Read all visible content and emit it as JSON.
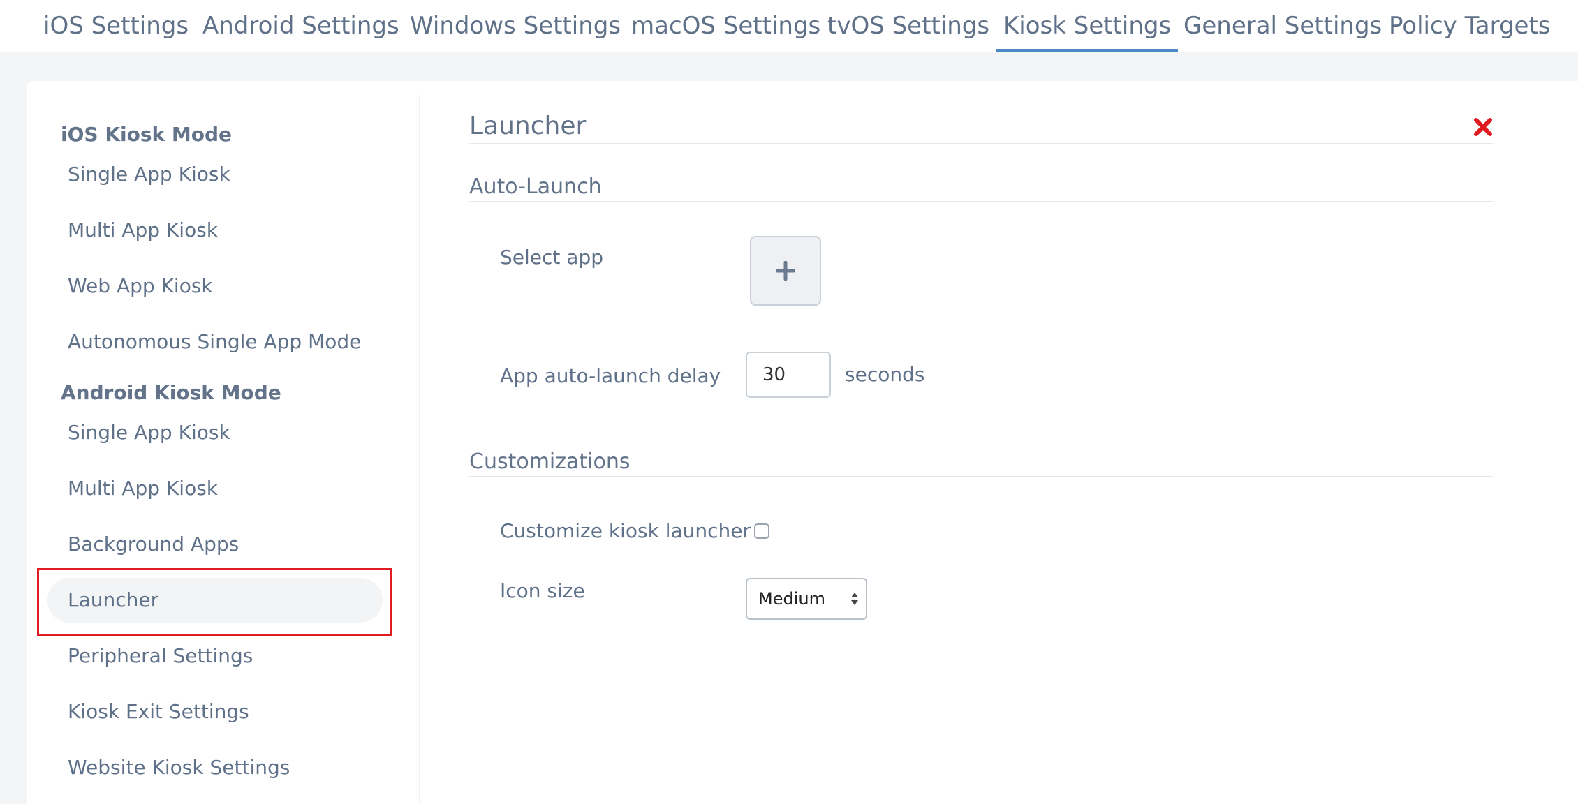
{
  "tabs": [
    {
      "label": "iOS Settings",
      "active": false
    },
    {
      "label": "Android Settings",
      "active": false
    },
    {
      "label": "Windows Settings",
      "active": false
    },
    {
      "label": "macOS Settings",
      "active": false
    },
    {
      "label": "tvOS Settings",
      "active": false
    },
    {
      "label": "Kiosk Settings",
      "active": true
    },
    {
      "label": "General Settings",
      "active": false
    },
    {
      "label": "Policy Targets",
      "active": false
    }
  ],
  "sidebar": {
    "ios_group": "iOS Kiosk Mode",
    "ios_items": [
      "Single App Kiosk",
      "Multi App Kiosk",
      "Web App Kiosk",
      "Autonomous Single App Mode"
    ],
    "android_group": "Android Kiosk Mode",
    "android_items": [
      "Single App Kiosk",
      "Multi App Kiosk",
      "Background Apps",
      "Launcher",
      "Peripheral Settings",
      "Kiosk Exit Settings",
      "Website Kiosk Settings"
    ],
    "selected": "Launcher"
  },
  "panel": {
    "title": "Launcher",
    "close_icon": "close-x-icon",
    "auto_launch": {
      "section_title": "Auto-Launch",
      "select_app_label": "Select app",
      "add_icon": "plus-icon",
      "delay_label": "App auto-launch delay",
      "delay_value": "30",
      "delay_units": "seconds"
    },
    "customizations": {
      "section_title": "Customizations",
      "customize_label": "Customize kiosk launcher",
      "customize_checked": false,
      "icon_size_label": "Icon size",
      "icon_size_value": "Medium"
    }
  },
  "colors": {
    "accent": "#4a88c6",
    "highlight_border": "#e01b22",
    "close_icon": "#e01b22",
    "text": "#5f7189"
  }
}
